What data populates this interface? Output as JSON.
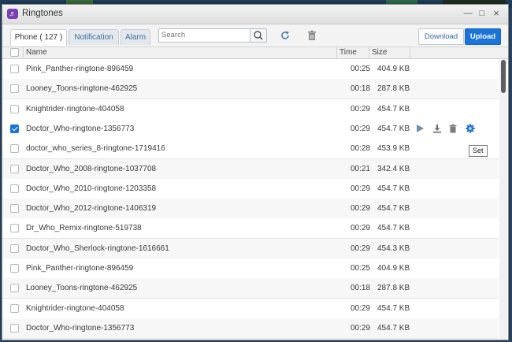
{
  "window": {
    "title": "Ringtones"
  },
  "tabs": [
    {
      "label": "Phone ( 127 )",
      "active": true
    },
    {
      "label": "Notification",
      "active": false
    },
    {
      "label": "Alarm",
      "active": false
    }
  ],
  "search": {
    "placeholder": "Search",
    "value": ""
  },
  "toolbar": {
    "download_label": "Download",
    "upload_label": "Upload"
  },
  "table": {
    "columns": [
      "Name",
      "Time",
      "Size"
    ],
    "rows": [
      {
        "name": "Pink_Panther-ringtone-896459",
        "time": "00:25",
        "size": "404.9 KB",
        "checked": false
      },
      {
        "name": "Looney_Toons-ringtone-462925",
        "time": "00:18",
        "size": "287.8 KB",
        "checked": false
      },
      {
        "name": "Knightrider-ringtone-404058",
        "time": "00:29",
        "size": "454.7 KB",
        "checked": false
      },
      {
        "name": "Doctor_Who-ringtone-1356773",
        "time": "00:29",
        "size": "454.7 KB",
        "checked": true
      },
      {
        "name": "doctor_who_series_8-ringtone-1719416",
        "time": "00:28",
        "size": "453.9 KB",
        "checked": false
      },
      {
        "name": "Doctor_Who_2008-ringtone-1037708",
        "time": "00:21",
        "size": "342.4 KB",
        "checked": false
      },
      {
        "name": "Doctor_Who_2010-ringtone-1203358",
        "time": "00:29",
        "size": "454.7 KB",
        "checked": false
      },
      {
        "name": "Doctor_Who_2012-ringtone-1406319",
        "time": "00:29",
        "size": "454.7 KB",
        "checked": false
      },
      {
        "name": "Dr_Who_Remix-ringtone-519738",
        "time": "00:29",
        "size": "454.7 KB",
        "checked": false
      },
      {
        "name": "Doctor_Who_Sherlock-ringtone-1616661",
        "time": "00:29",
        "size": "454.3 KB",
        "checked": false
      },
      {
        "name": "Pink_Panther-ringtone-896459",
        "time": "00:25",
        "size": "404.9 KB",
        "checked": false
      },
      {
        "name": "Looney_Toons-ringtone-462925",
        "time": "00:18",
        "size": "287.8 KB",
        "checked": false
      },
      {
        "name": "Knightrider-ringtone-404058",
        "time": "00:29",
        "size": "454.7 KB",
        "checked": false
      },
      {
        "name": "Doctor_Who-ringtone-1356773",
        "time": "00:29",
        "size": "454.7 KB",
        "checked": false
      }
    ]
  },
  "row_actions": [
    "play-icon",
    "download-icon",
    "delete-icon",
    "set-gear-icon"
  ],
  "tooltip": {
    "text": "Set"
  },
  "colors": {
    "accent": "#1a73d9",
    "app_icon": "#7b3fb3",
    "tab_text": "#3d6f9e"
  }
}
